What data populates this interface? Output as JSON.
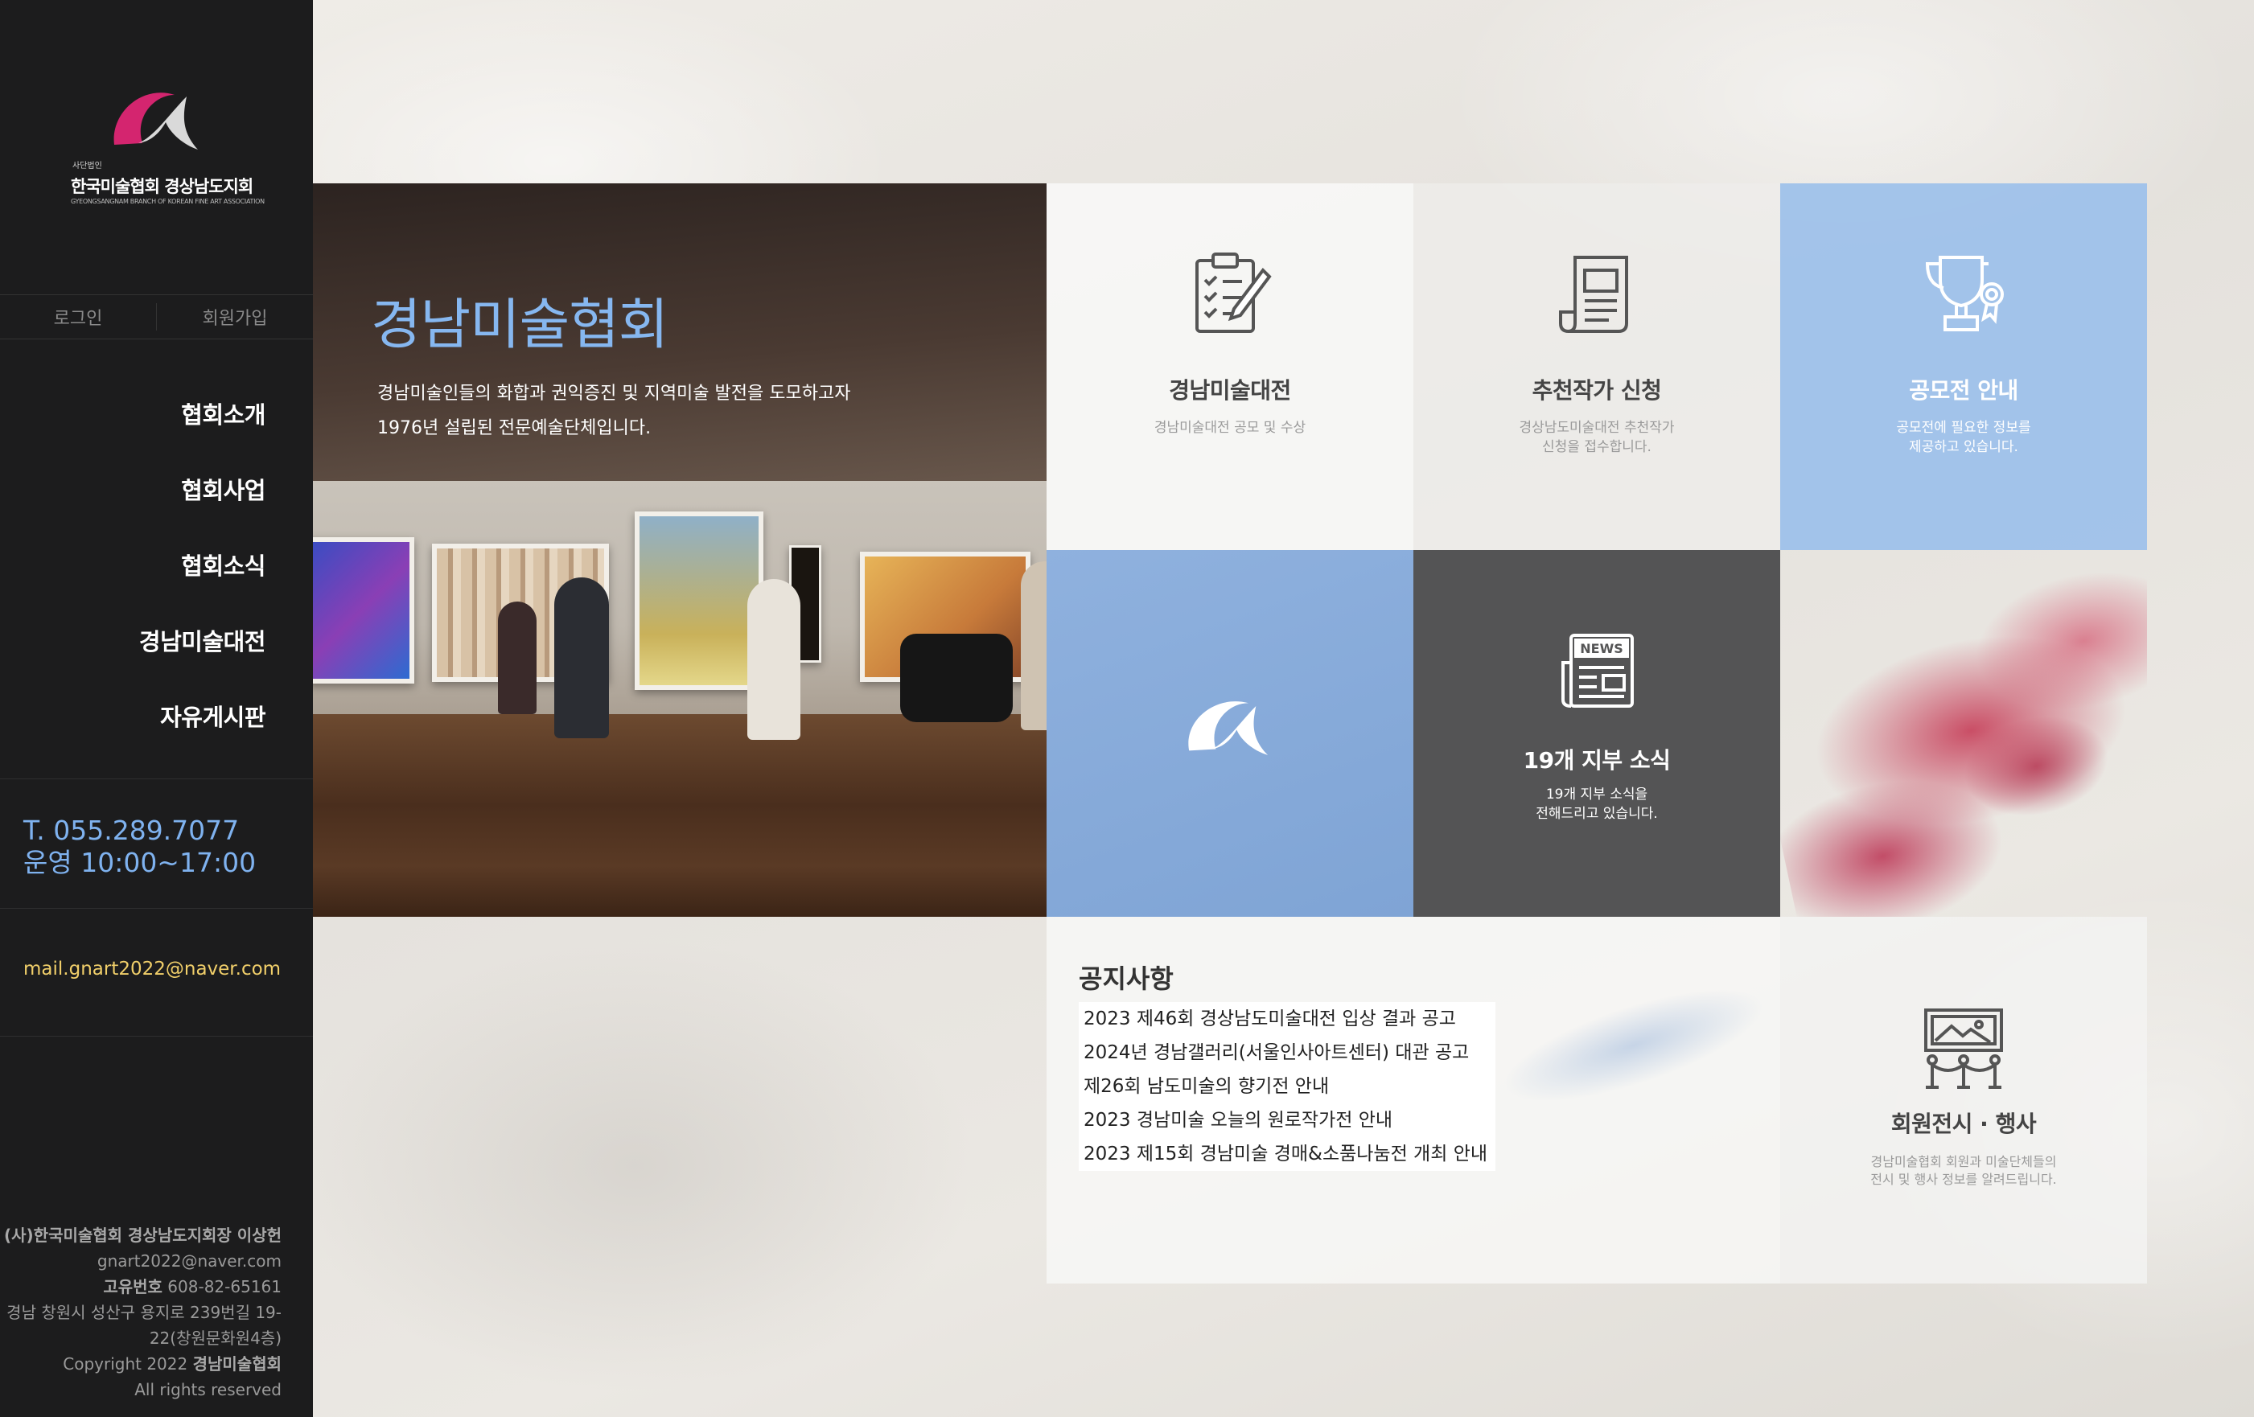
{
  "logo": {
    "small": "사단법인",
    "title": "한국미술협회 경상남도지회",
    "subtitle": "GYEONGSANGNAM BRANCH OF KOREAN FINE ART ASSOCIATION"
  },
  "auth": {
    "login": "로그인",
    "signup": "회원가입"
  },
  "nav": [
    "협회소개",
    "협회사업",
    "협회소식",
    "경남미술대전",
    "자유게시판"
  ],
  "contact": {
    "phone": "T. 055.289.7077",
    "hours": "운영 10:00~17:00",
    "mail": "mail.gnart2022@naver.com"
  },
  "footer": {
    "line1": "(사)한국미술협회 경상남도지회장 이상헌",
    "email": "gnart2022@naver.com",
    "biz_label": "고유번호",
    "biz_no": " 608-82-65161",
    "addr1": "경남 창원시 성산구 용지로 239번길 19-",
    "addr2": "22(창원문화원4층)",
    "copy_prefix": "Copyright 2022 ",
    "copy_name": "경남미술협회",
    "rights": "All rights reserved"
  },
  "hero": {
    "title": "경남미술협회",
    "line1": "경남미술인들의 화합과 권익증진 및 지역미술 발전을 도모하고자",
    "line2": "1976년 설립된 전문예술단체입니다."
  },
  "tiles": {
    "exhibition": {
      "icon": "clipboard-icon",
      "title": "경남미술대전",
      "desc1": "경남미술대전 공모 및 수상",
      "desc2": ""
    },
    "recommend": {
      "icon": "document-icon",
      "title": "추천작가 신청",
      "desc1": "경상남도미술대전 추천작가",
      "desc2": "신청을 접수합니다."
    },
    "contest": {
      "icon": "trophy-icon",
      "title": "공모전 안내",
      "desc1": "공모전에 필요한 정보를",
      "desc2": "제공하고 있습니다."
    },
    "news": {
      "icon": "newspaper-icon",
      "badge": "NEWS",
      "title": "19개 지부 소식",
      "desc1": "19개 지부 소식을",
      "desc2": "전해드리고 있습니다."
    },
    "member": {
      "icon": "gallery-icon",
      "title": "회원전시 · 행사",
      "desc1": "경남미술협회 회원과 미술단체들의",
      "desc2": "전시 및 행사 정보를 알려드립니다."
    }
  },
  "notice": {
    "title": "공지사항",
    "items": [
      "2023 제46회 경상남도미술대전 입상 결과 공고",
      "2024년 경남갤러리(서울인사아트센터) 대관 공고",
      "제26회 남도미술의 향기전 안내",
      "2023 경남미술 오늘의 원로작가전 안내",
      "2023 제15회 경남미술 경매&소품나눔전 개최 안내"
    ]
  },
  "colors": {
    "accent_blue": "#86b7f0",
    "mail_yellow": "#f1cf6a",
    "logo_pink": "#d4256f",
    "sidebar": "#1c1c1d"
  }
}
